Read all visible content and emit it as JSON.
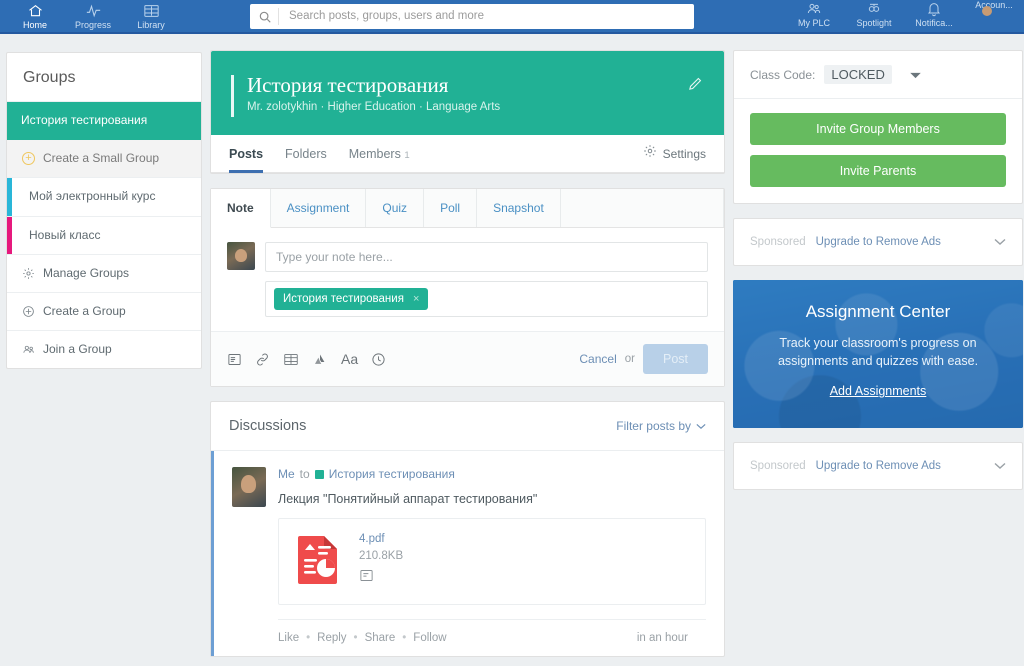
{
  "topnav": {
    "items": [
      {
        "label": "Home",
        "icon": "home-icon",
        "active": true
      },
      {
        "label": "Progress",
        "icon": "progress-icon",
        "active": false
      },
      {
        "label": "Library",
        "icon": "library-icon",
        "active": false
      }
    ],
    "right_items": [
      {
        "label": "My PLC",
        "icon": "plc-icon"
      },
      {
        "label": "Spotlight",
        "icon": "spotlight-icon"
      },
      {
        "label": "Notifica...",
        "icon": "bell-icon"
      },
      {
        "label": "Accoun...",
        "icon": "account-avatar"
      }
    ],
    "search": {
      "placeholder": "Search posts, groups, users and more",
      "value": "",
      "icon": "search-icon"
    }
  },
  "sidebar": {
    "title": "Groups",
    "items": [
      {
        "label": "История тестирования",
        "state": "selected",
        "stripe": ""
      },
      {
        "label": "Create a Small Group",
        "state": "create-small",
        "stripe": "",
        "icon": "plus-circle-icon"
      },
      {
        "label": "Мой электронный курс",
        "state": "normal",
        "stripe": "#29b6d8"
      },
      {
        "label": "Новый класс",
        "state": "normal",
        "stripe": "#e6197d"
      },
      {
        "label": "Manage Groups",
        "state": "normal",
        "stripe": "",
        "icon": "gear-icon"
      },
      {
        "label": "Create a Group",
        "state": "normal",
        "stripe": "",
        "icon": "plus-outline-icon"
      },
      {
        "label": "Join a Group",
        "state": "normal",
        "stripe": "",
        "icon": "people-icon"
      }
    ]
  },
  "group": {
    "title": "История тестирования",
    "subtitle": "Mr. zolotykhin · Higher Education · Language Arts",
    "edit_icon": "pencil-icon",
    "tabs": [
      {
        "label": "Posts",
        "count": "",
        "active": true
      },
      {
        "label": "Folders",
        "count": "",
        "active": false
      },
      {
        "label": "Members",
        "count": "1",
        "active": false
      }
    ],
    "settings_label": "Settings",
    "settings_icon": "gear-icon"
  },
  "composer": {
    "tabs": [
      {
        "label": "Note",
        "active": true
      },
      {
        "label": "Assignment",
        "active": false
      },
      {
        "label": "Quiz",
        "active": false
      },
      {
        "label": "Poll",
        "active": false
      },
      {
        "label": "Snapshot",
        "active": false
      }
    ],
    "note_placeholder": "Type your note here...",
    "note_value": "",
    "tag": {
      "label": "История тестирования",
      "remove": "×"
    },
    "tools": [
      "attach-file-icon",
      "link-icon",
      "library-icon",
      "google-drive-icon",
      "text-format-icon",
      "schedule-clock-icon"
    ],
    "cancel_label": "Cancel",
    "or_label": "or",
    "post_label": "Post"
  },
  "discussions": {
    "title": "Discussions",
    "filter_label": "Filter posts by",
    "filter_icon": "chevron-down-icon",
    "post": {
      "author": "Me",
      "to": "to",
      "group": "История тестирования",
      "text": "Лекция \"Понятийный аппарат тестирования\"",
      "attachment": {
        "icon": "pdf-file-icon",
        "name": "4.pdf",
        "size": "210.8KB",
        "mini_icon": "document-icon"
      },
      "actions": [
        "Like",
        "Reply",
        "Share",
        "Follow"
      ],
      "separator": "•",
      "time": "in an hour"
    }
  },
  "rail": {
    "class_code_label": "Class Code:",
    "class_code_value": "LOCKED",
    "class_code_caret": "caret-down-icon",
    "invite_members_label": "Invite Group Members",
    "invite_parents_label": "Invite Parents",
    "sponsored_top": {
      "label": "Sponsored",
      "link": "Upgrade to Remove Ads",
      "caret": "chevron-down-icon"
    },
    "promo": {
      "title": "Assignment Center",
      "subtitle": "Track your classroom's progress on assignments and quizzes with ease.",
      "link": "Add Assignments"
    },
    "sponsored_bottom": {
      "label": "Sponsored",
      "link": "Upgrade to Remove Ads",
      "caret": "chevron-down-icon"
    }
  },
  "colors": {
    "nav_blue": "#2e6db4",
    "group_green": "#21b195",
    "invite_green": "#66bb5f",
    "promo_blue": "#2e7fc6",
    "link_blue": "#6d8fb5",
    "stripe_cyan": "#29b6d8",
    "stripe_pink": "#e6197d"
  }
}
